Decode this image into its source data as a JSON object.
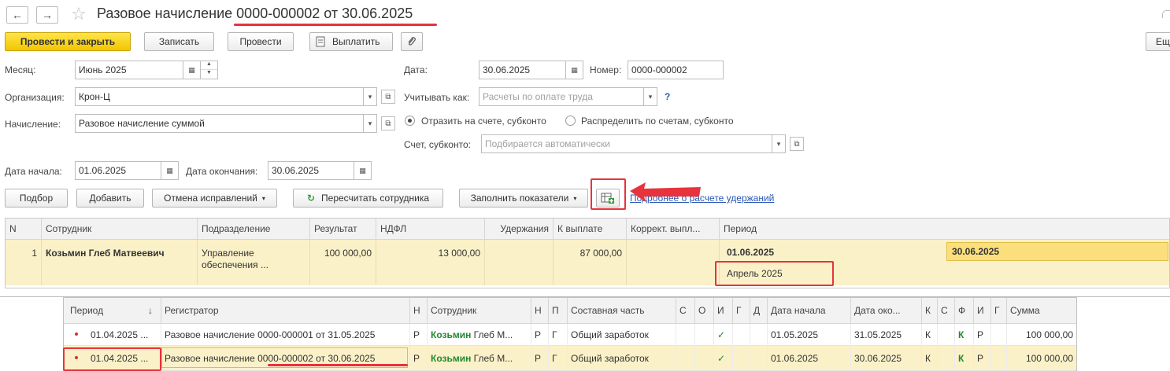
{
  "header": {
    "back_icon": "←",
    "forward_icon": "→",
    "star_icon": "☆",
    "title_prefix": "Разовое начисление ",
    "title_doc": "0000-000002 от 30.06.2025",
    "right_btn": "Ещ"
  },
  "toolbar": {
    "post_close": "Провести и закрыть",
    "save": "Записать",
    "post": "Провести",
    "pay": "Выплатить"
  },
  "form": {
    "month_label": "Месяц:",
    "month_value": "Июнь 2025",
    "org_label": "Организация:",
    "org_value": "Крон-Ц",
    "accrual_label": "Начисление:",
    "accrual_value": "Разовое начисление суммой",
    "date_label": "Дата:",
    "date_value": "30.06.2025",
    "number_label": "Номер:",
    "number_value": "0000-000002",
    "account_as_label": "Учитывать как:",
    "account_as_placeholder": "Расчеты по оплате труда",
    "help_icon": "?",
    "radio_reflect": "Отразить на счете, субконто",
    "radio_distribute": "Распределить по счетам, субконто",
    "subconto_label": "Счет, субконто:",
    "subconto_placeholder": "Подбирается автоматически",
    "start_label": "Дата начала:",
    "start_value": "01.06.2025",
    "end_label": "Дата окончания:",
    "end_value": "30.06.2025"
  },
  "table_toolbar": {
    "select": "Подбор",
    "add": "Добавить",
    "cancel_fix": "Отмена исправлений",
    "recalc": "Пересчитать сотрудника",
    "fill": "Заполнить показатели",
    "link_deductions": "Подробнее о расчете удержаний"
  },
  "table": {
    "columns": [
      "N",
      "Сотрудник",
      "Подразделение",
      "Результат",
      "НДФЛ",
      "Удержания",
      "К выплате",
      "Коррект. выпл...",
      "Период"
    ],
    "row": {
      "n": "1",
      "employee": "Козьмин Глеб Матвеевич",
      "dept_line1": "Управление",
      "dept_line2": "обеспечения ...",
      "result": "100 000,00",
      "ndfl": "13 000,00",
      "deductions": "",
      "payout": "87 000,00",
      "correction": "",
      "period_start": "01.06.2025",
      "period_end": "30.06.2025",
      "period_month": "Апрель 2025"
    }
  },
  "register": {
    "columns": [
      "Период",
      "Регистратор",
      "Н",
      "Сотрудник",
      "Н",
      "П",
      "Составная часть",
      "С",
      "О",
      "И",
      "Г",
      "Д",
      "Дата начала",
      "Дата око...",
      "К",
      "С",
      "Ф",
      "И",
      "Г",
      "Сумма"
    ],
    "sort_icon": "↓",
    "rows": [
      {
        "period": "01.04.2025 ...",
        "registrar": "Разовое начисление 0000-000001 от 31.05.2025",
        "n1": "Р",
        "emp_bold": "Козьмин",
        "emp_rest": " Глеб М...",
        "n2": "Р",
        "p": "Г",
        "part": "Общий заработок",
        "check": "✓",
        "start": "01.05.2025",
        "end": "31.05.2025",
        "k": "К",
        "k2": "К",
        "r": "Р",
        "sum": "100 000,00"
      },
      {
        "period": "01.04.2025 ...",
        "registrar": "Разовое начисление 0000-000002 от 30.06.2025",
        "n1": "Р",
        "emp_bold": "Козьмин",
        "emp_rest": " Глеб М...",
        "n2": "Р",
        "p": "Г",
        "part": "Общий заработок",
        "check": "✓",
        "start": "01.06.2025",
        "end": "30.06.2025",
        "k": "К",
        "k2": "К",
        "r": "Р",
        "sum": "100 000,00"
      }
    ]
  },
  "colors": {
    "accent_red": "#e8323c",
    "primary_yellow": "#f3c500",
    "row_highlight": "#fbf1c8",
    "link_blue": "#2a57b5",
    "green": "#1e8b2e"
  }
}
